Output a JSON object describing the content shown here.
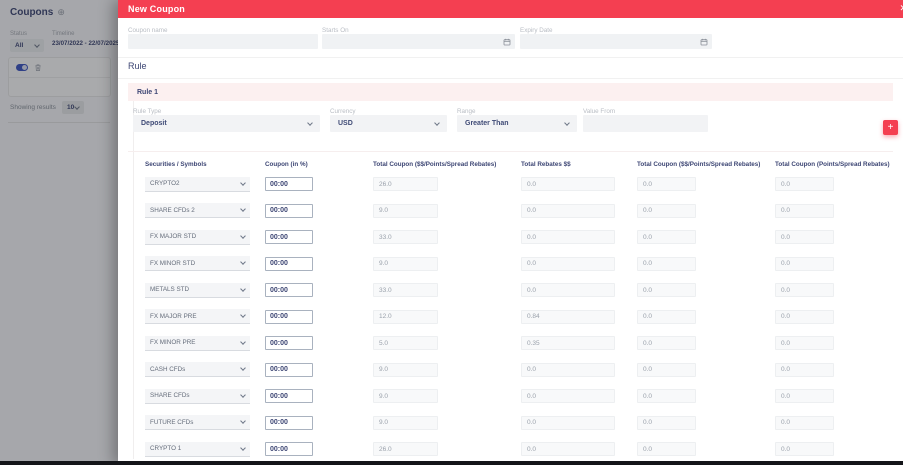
{
  "colors": {
    "accent": "#f43f51",
    "navy": "#3d4674"
  },
  "sidebar": {
    "title": "Coupons",
    "add_icon": "⊕",
    "status": {
      "label": "Status",
      "value": "All"
    },
    "timeline": {
      "label": "Timeline",
      "value": "23/07/2022 - 22/07/2025"
    },
    "showing_results": {
      "label": "Showing results",
      "value": "10"
    }
  },
  "drawer": {
    "title": "New Coupon",
    "close_icon": "✕",
    "form": {
      "coupon_name": {
        "label": "Coupon name",
        "value": ""
      },
      "starts_on": {
        "label": "Starts On",
        "value": ""
      },
      "expiry_date": {
        "label": "Expiry Date",
        "value": ""
      }
    },
    "rule": {
      "heading": "Rule",
      "rule_title": "Rule 1",
      "rule_type": {
        "label": "Rule Type",
        "value": "Deposit"
      },
      "currency": {
        "label": "Currency",
        "value": "USD"
      },
      "range": {
        "label": "Range",
        "value": "Greater Than"
      },
      "value_from": {
        "label": "Value From",
        "value": ""
      },
      "add_button": "+"
    },
    "table": {
      "headers": [
        "Securities / Symbols",
        "Coupon (in %)",
        "Total Coupon ($$/Points/Spread Rebates)",
        "Total Rebates $$",
        "Total Coupon ($$/Points/Spread Rebates)",
        "Total Coupon (Points/Spread Rebates)"
      ],
      "rows": [
        {
          "security": "CRYPTO2",
          "coupon": "00:00",
          "total_coupon": "26.0",
          "total_rebates": "0.0",
          "total_coupon_2": "0.0",
          "total_coupon_3": "0.0"
        },
        {
          "security": "SHARE CFDs 2",
          "coupon": "00:00",
          "total_coupon": "9.0",
          "total_rebates": "0.0",
          "total_coupon_2": "0.0",
          "total_coupon_3": "0.0"
        },
        {
          "security": "FX MAJOR STD",
          "coupon": "00:00",
          "total_coupon": "33.0",
          "total_rebates": "0.0",
          "total_coupon_2": "0.0",
          "total_coupon_3": "0.0"
        },
        {
          "security": "FX MINOR STD",
          "coupon": "00:00",
          "total_coupon": "9.0",
          "total_rebates": "0.0",
          "total_coupon_2": "0.0",
          "total_coupon_3": "0.0"
        },
        {
          "security": "METALS STD",
          "coupon": "00:00",
          "total_coupon": "33.0",
          "total_rebates": "0.0",
          "total_coupon_2": "0.0",
          "total_coupon_3": "0.0"
        },
        {
          "security": "FX MAJOR PRE",
          "coupon": "00:00",
          "total_coupon": "12.0",
          "total_rebates": "0.84",
          "total_coupon_2": "0.0",
          "total_coupon_3": "0.0"
        },
        {
          "security": "FX MINOR PRE",
          "coupon": "00:00",
          "total_coupon": "5.0",
          "total_rebates": "0.35",
          "total_coupon_2": "0.0",
          "total_coupon_3": "0.0"
        },
        {
          "security": "CASH CFDs",
          "coupon": "00:00",
          "total_coupon": "9.0",
          "total_rebates": "0.0",
          "total_coupon_2": "0.0",
          "total_coupon_3": "0.0"
        },
        {
          "security": "SHARE CFDs",
          "coupon": "00:00",
          "total_coupon": "9.0",
          "total_rebates": "0.0",
          "total_coupon_2": "0.0",
          "total_coupon_3": "0.0"
        },
        {
          "security": "FUTURE CFDs",
          "coupon": "00:00",
          "total_coupon": "9.0",
          "total_rebates": "0.0",
          "total_coupon_2": "0.0",
          "total_coupon_3": "0.0"
        },
        {
          "security": "CRYPTO 1",
          "coupon": "00:00",
          "total_coupon": "26.0",
          "total_rebates": "0.0",
          "total_coupon_2": "0.0",
          "total_coupon_3": "0.0"
        }
      ]
    }
  }
}
